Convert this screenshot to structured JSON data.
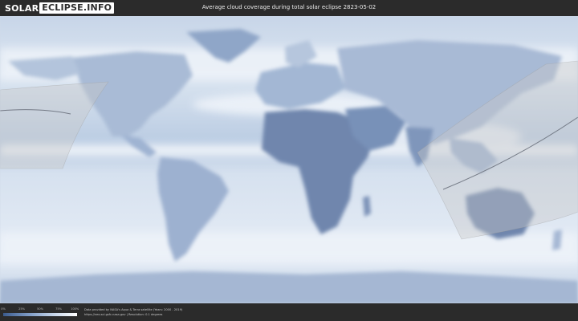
{
  "header": {
    "logo_part1": "SOLAR",
    "logo_part2": "ECLIPSE.INFO",
    "title": "Average cloud coverage during total solar eclipse 2823-05-02"
  },
  "legend": {
    "ticks": [
      "0%",
      "25%",
      "50%",
      "75%",
      "100%"
    ],
    "colors": [
      "#3c5c8e",
      "#7f9cc6",
      "#c9d7ea",
      "#ffffff"
    ]
  },
  "footer": {
    "credit_line1": "Data provided by NASA's Aqua & Terra satellite (Years: 2000 - 2019)",
    "credit_line2": "https://neo.sci.gsfc.nasa.gov | Resolution: 0.1 degrees"
  },
  "map": {
    "ocean_color": "#dce6f1",
    "cloud_color": "#f1f5fa",
    "land_dark_color": "#6f86ad",
    "eclipse_zone_color": "#c9c9c9"
  }
}
